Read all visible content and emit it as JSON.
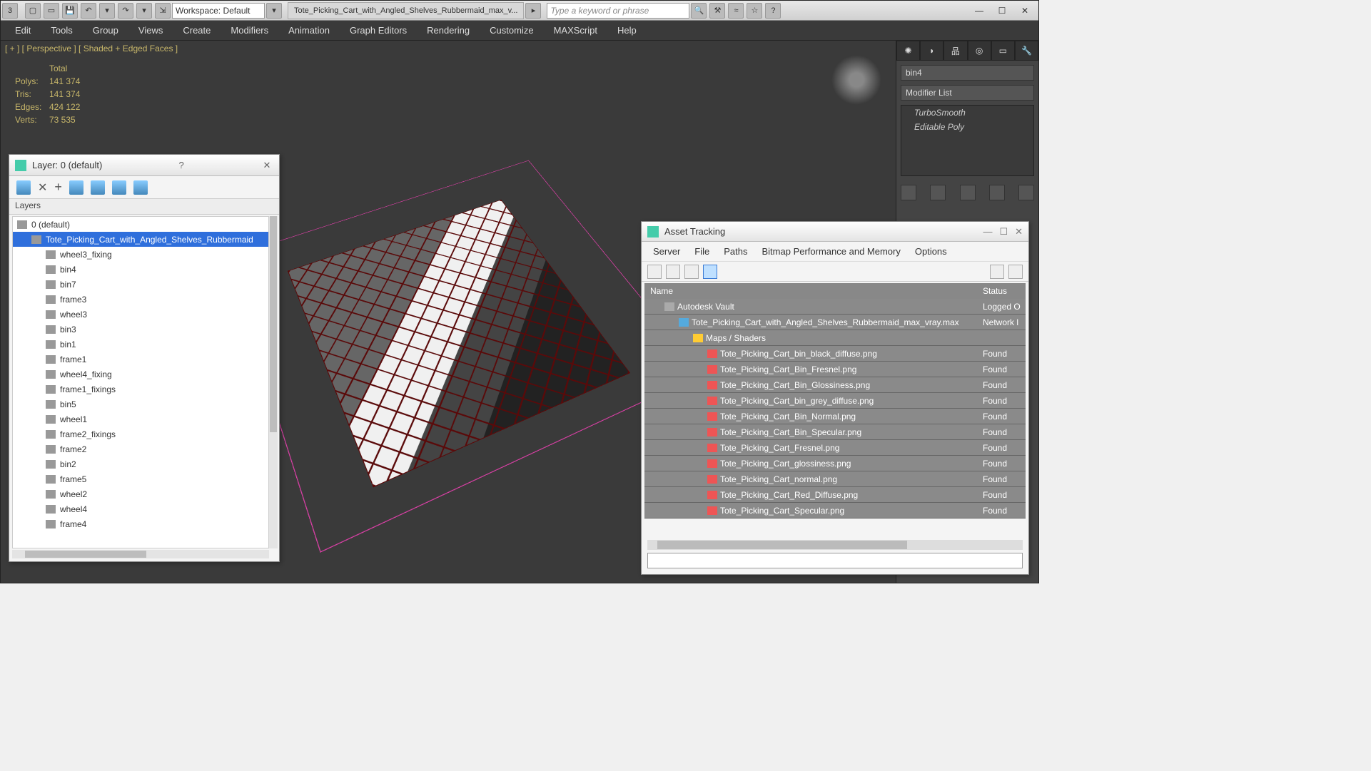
{
  "toolbar": {
    "workspace_label": "Workspace: Default",
    "file_tab": "Tote_Picking_Cart_with_Angled_Shelves_Rubbermaid_max_v...",
    "search_placeholder": "Type a keyword or phrase"
  },
  "menus": [
    "Edit",
    "Tools",
    "Group",
    "Views",
    "Create",
    "Modifiers",
    "Animation",
    "Graph Editors",
    "Rendering",
    "Customize",
    "MAXScript",
    "Help"
  ],
  "viewport": {
    "label": "[ + ] [ Perspective ] [ Shaded + Edged Faces ]",
    "stats": {
      "total": "Total",
      "polys_k": "Polys:",
      "polys_v": "141 374",
      "tris_k": "Tris:",
      "tris_v": "141 374",
      "edges_k": "Edges:",
      "edges_v": "424 122",
      "verts_k": "Verts:",
      "verts_v": "73 535"
    }
  },
  "cmdpanel": {
    "object_name": "bin4",
    "modifier_list_label": "Modifier List",
    "stack": [
      "TurboSmooth",
      "Editable Poly"
    ]
  },
  "layer_window": {
    "title": "Layer: 0 (default)",
    "header": "Layers",
    "items": [
      {
        "lvl": 0,
        "label": "0 (default)",
        "sel": false
      },
      {
        "lvl": 1,
        "label": "Tote_Picking_Cart_with_Angled_Shelves_Rubbermaid",
        "sel": true
      },
      {
        "lvl": 2,
        "label": "wheel3_fixing"
      },
      {
        "lvl": 2,
        "label": "bin4"
      },
      {
        "lvl": 2,
        "label": "bin7"
      },
      {
        "lvl": 2,
        "label": "frame3"
      },
      {
        "lvl": 2,
        "label": "wheel3"
      },
      {
        "lvl": 2,
        "label": "bin3"
      },
      {
        "lvl": 2,
        "label": "bin1"
      },
      {
        "lvl": 2,
        "label": "frame1"
      },
      {
        "lvl": 2,
        "label": "wheel4_fixing"
      },
      {
        "lvl": 2,
        "label": "frame1_fixings"
      },
      {
        "lvl": 2,
        "label": "bin5"
      },
      {
        "lvl": 2,
        "label": "wheel1"
      },
      {
        "lvl": 2,
        "label": "frame2_fixings"
      },
      {
        "lvl": 2,
        "label": "frame2"
      },
      {
        "lvl": 2,
        "label": "bin2"
      },
      {
        "lvl": 2,
        "label": "frame5"
      },
      {
        "lvl": 2,
        "label": "wheel2"
      },
      {
        "lvl": 2,
        "label": "wheel4"
      },
      {
        "lvl": 2,
        "label": "frame4"
      }
    ]
  },
  "asset_window": {
    "title": "Asset Tracking",
    "menus": [
      "Server",
      "File",
      "Paths",
      "Bitmap Performance and Memory",
      "Options"
    ],
    "col_name": "Name",
    "col_status": "Status",
    "rows": [
      {
        "lvl": 1,
        "ico": "vault",
        "name": "Autodesk Vault",
        "status": "Logged O"
      },
      {
        "lvl": 2,
        "ico": "max",
        "name": "Tote_Picking_Cart_with_Angled_Shelves_Rubbermaid_max_vray.max",
        "status": "Network l"
      },
      {
        "lvl": 3,
        "ico": "fold",
        "name": "Maps / Shaders",
        "status": ""
      },
      {
        "lvl": 4,
        "ico": "png",
        "name": "Tote_Picking_Cart_bin_black_diffuse.png",
        "status": "Found"
      },
      {
        "lvl": 4,
        "ico": "png",
        "name": "Tote_Picking_Cart_Bin_Fresnel.png",
        "status": "Found"
      },
      {
        "lvl": 4,
        "ico": "png",
        "name": "Tote_Picking_Cart_Bin_Glossiness.png",
        "status": "Found"
      },
      {
        "lvl": 4,
        "ico": "png",
        "name": "Tote_Picking_Cart_bin_grey_diffuse.png",
        "status": "Found"
      },
      {
        "lvl": 4,
        "ico": "png",
        "name": "Tote_Picking_Cart_Bin_Normal.png",
        "status": "Found"
      },
      {
        "lvl": 4,
        "ico": "png",
        "name": "Tote_Picking_Cart_Bin_Specular.png",
        "status": "Found"
      },
      {
        "lvl": 4,
        "ico": "png",
        "name": "Tote_Picking_Cart_Fresnel.png",
        "status": "Found"
      },
      {
        "lvl": 4,
        "ico": "png",
        "name": "Tote_Picking_Cart_glossiness.png",
        "status": "Found"
      },
      {
        "lvl": 4,
        "ico": "png",
        "name": "Tote_Picking_Cart_normal.png",
        "status": "Found"
      },
      {
        "lvl": 4,
        "ico": "png",
        "name": "Tote_Picking_Cart_Red_Diffuse.png",
        "status": "Found"
      },
      {
        "lvl": 4,
        "ico": "png",
        "name": "Tote_Picking_Cart_Specular.png",
        "status": "Found"
      }
    ]
  }
}
